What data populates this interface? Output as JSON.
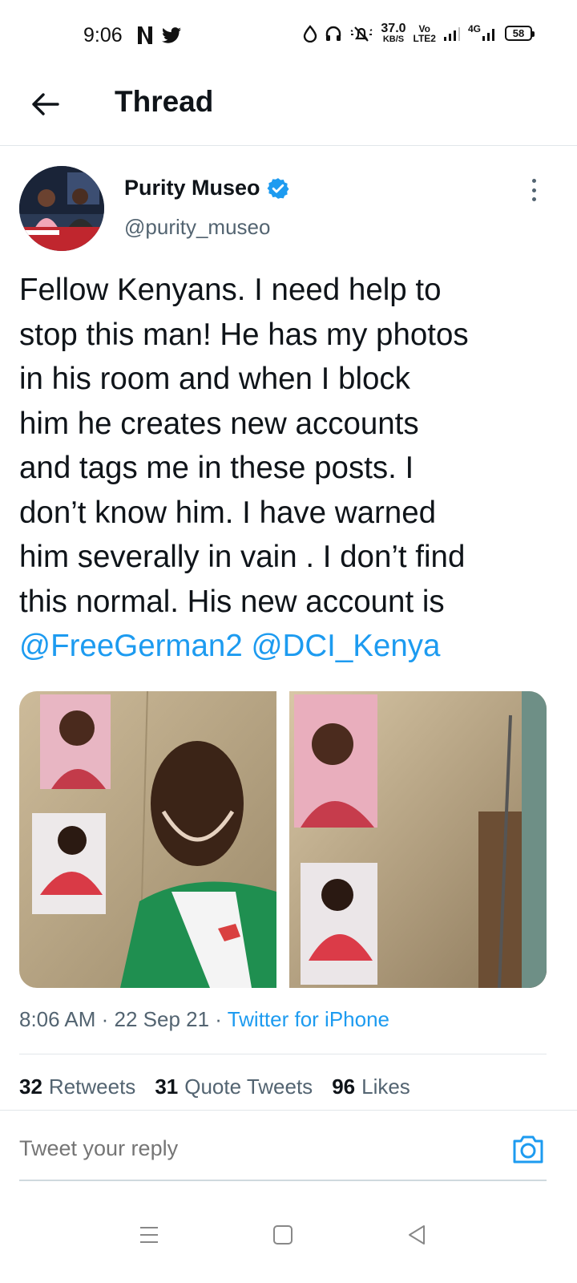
{
  "status_bar": {
    "time": "9:06",
    "left_icons": [
      "netflix-icon",
      "twitter-icon"
    ],
    "speed_value": "37.0",
    "speed_unit": "KB/S",
    "volte_top": "Vo",
    "volte_bottom": "LTE2",
    "network": "4G",
    "battery": "58"
  },
  "header": {
    "title": "Thread",
    "back_icon": "arrow-left-icon"
  },
  "tweet": {
    "author_name": "Purity Museo",
    "author_handle": "@purity_museo",
    "verified": true,
    "text_lines": [
      "Fellow Kenyans. I need help to",
      "stop this man! He has my photos",
      "in his room and when I block",
      "him he creates new accounts",
      "and tags me in these posts. I",
      "don’t know him. I have warned",
      "him severally in vain . I don’t find",
      "this normal. His new account is"
    ],
    "mentions": [
      "@FreeGerman2",
      "@DCI_Kenya"
    ],
    "timestamp": "8:06 AM · 22 Sep 21 · ",
    "source": "Twitter for iPhone",
    "stats": {
      "retweets_count": "32",
      "retweets_label": "Retweets",
      "quotes_count": "31",
      "quotes_label": "Quote Tweets",
      "likes_count": "96",
      "likes_label": "Likes"
    }
  },
  "reply": {
    "placeholder": "Tweet your reply",
    "camera_icon": "camera-icon"
  },
  "colors": {
    "accent": "#1d9bf0",
    "text": "#0f1419",
    "secondary": "#536471",
    "divider": "#e1e6ea"
  }
}
